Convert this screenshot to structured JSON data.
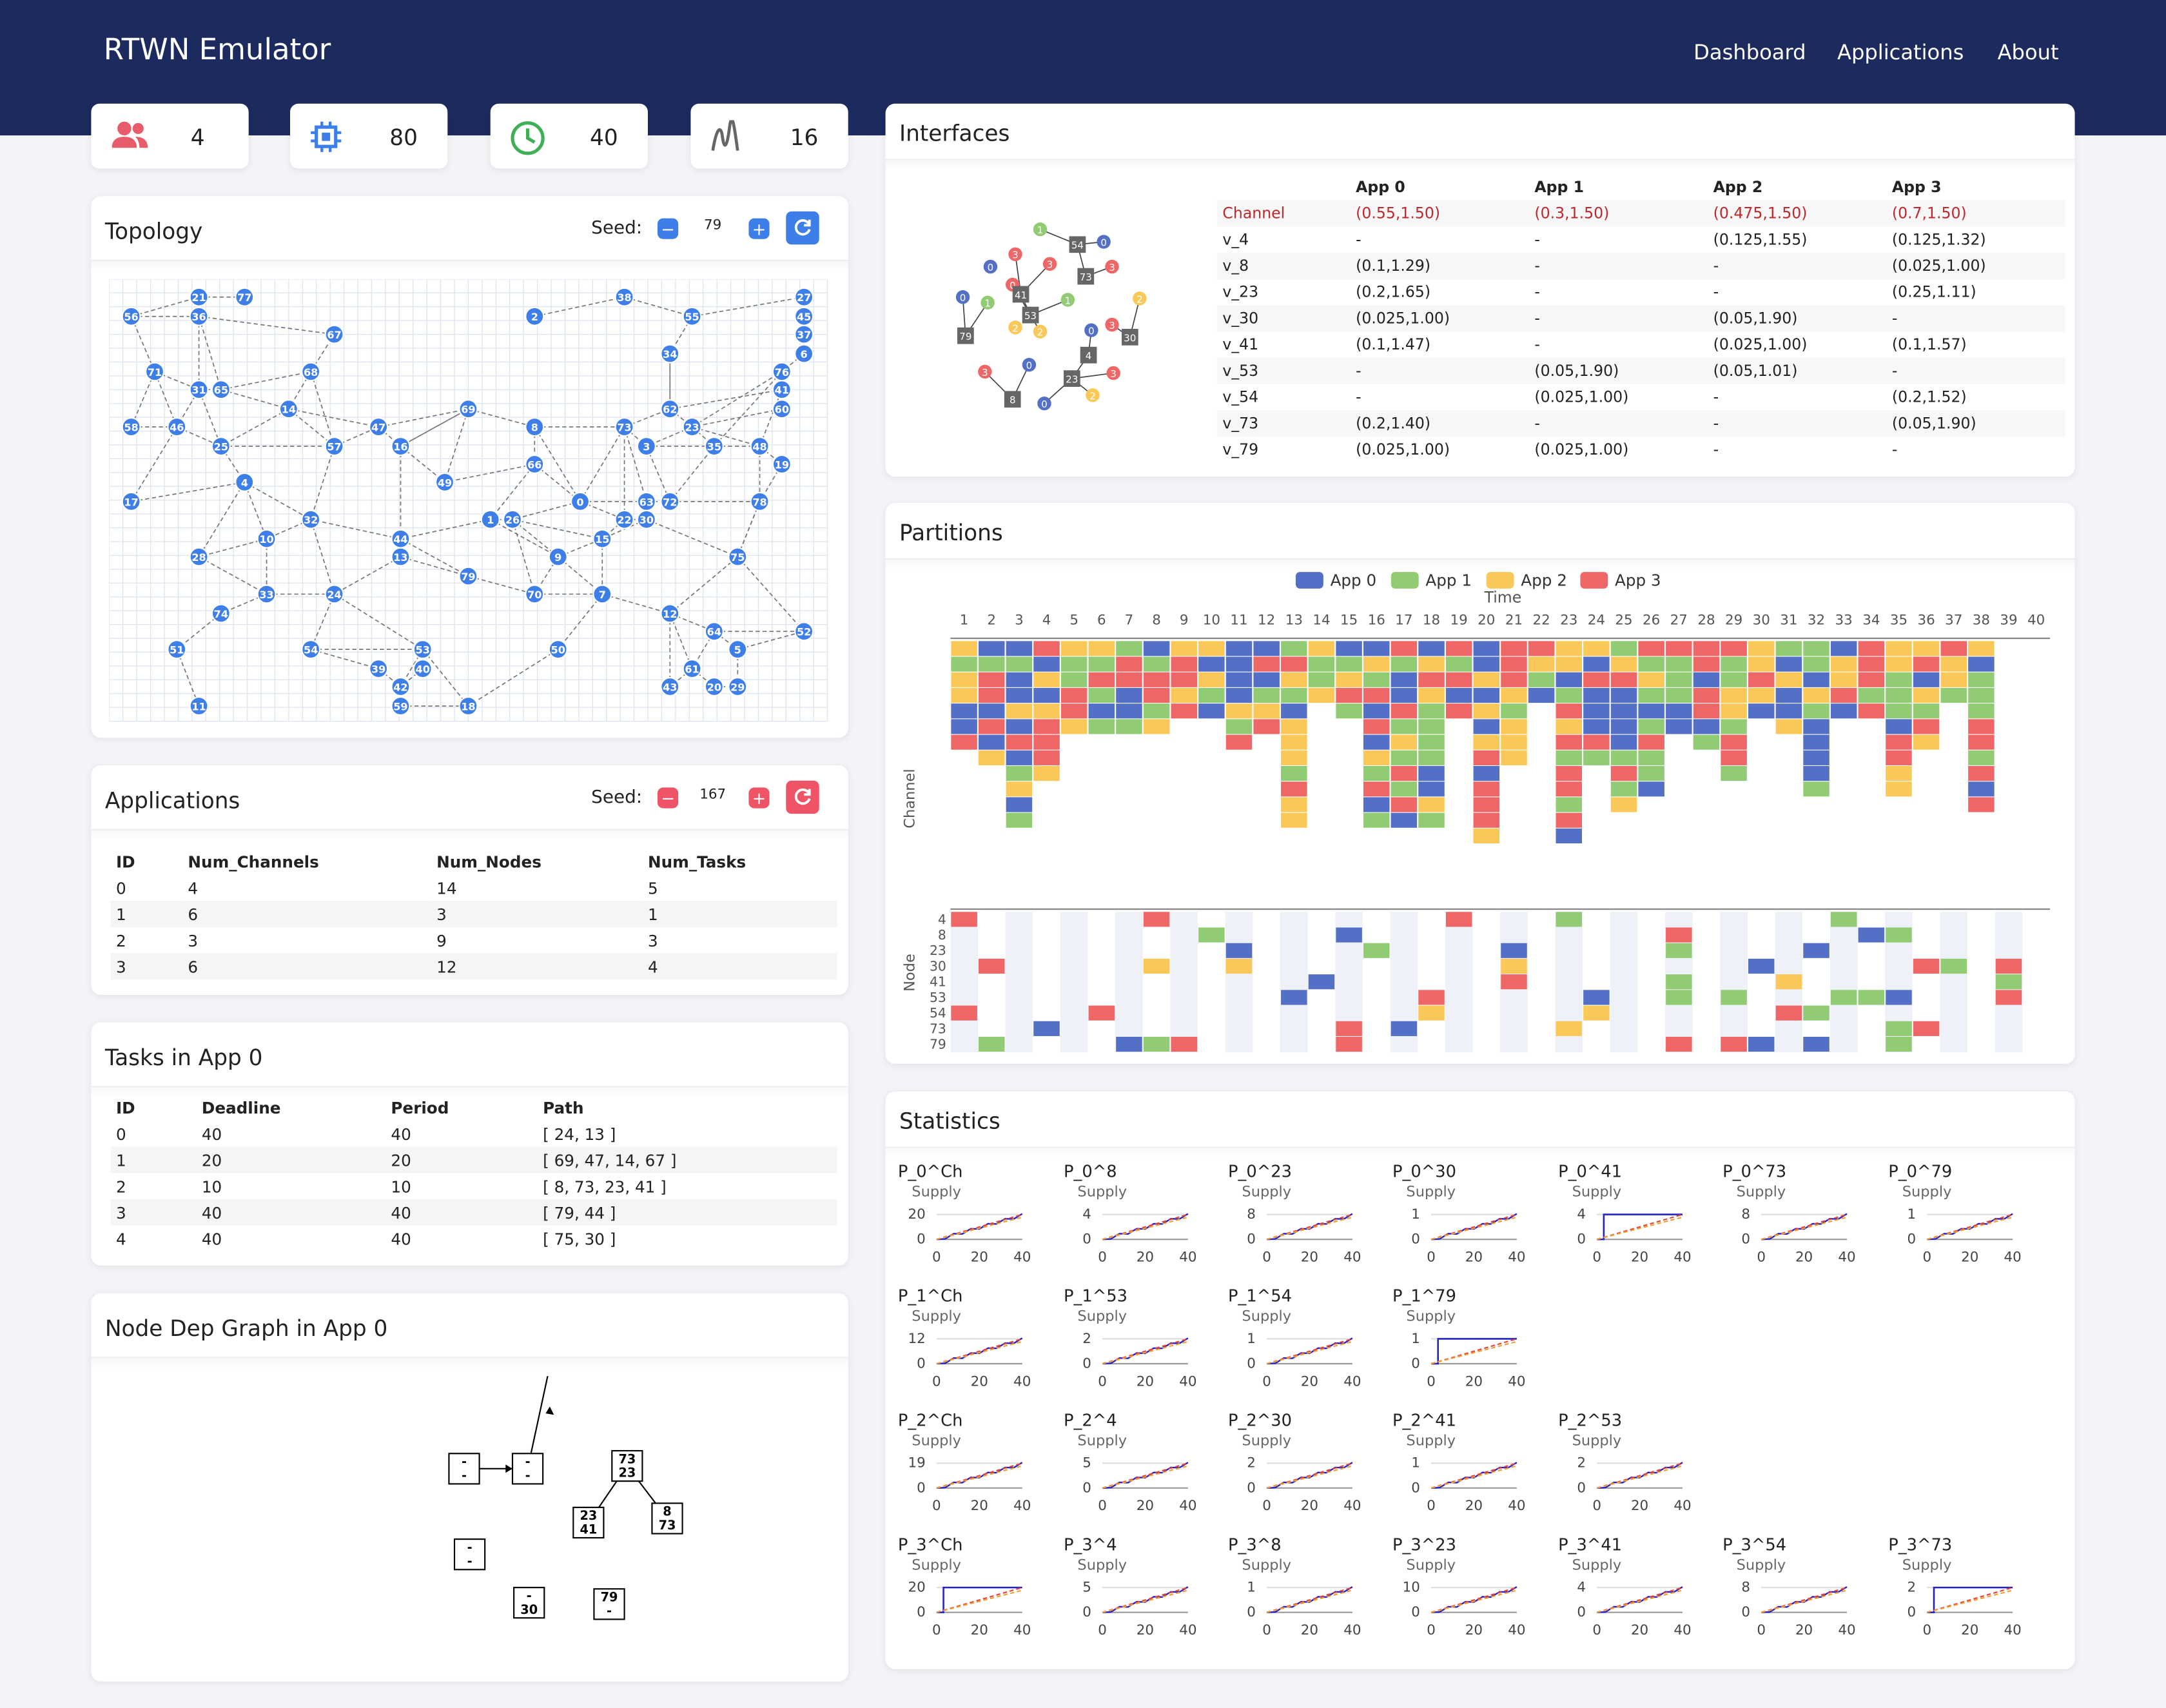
{
  "app": {
    "title": "RTWN Emulator",
    "nav": [
      "Dashboard",
      "Applications",
      "About"
    ]
  },
  "stats": {
    "apps": "4",
    "nodes": "80",
    "time": "40",
    "channels": "16"
  },
  "topology": {
    "title": "Topology",
    "seed_label": "Seed:",
    "seed": "79"
  },
  "applications": {
    "title": "Applications",
    "seed_label": "Seed:",
    "seed": "167",
    "columns": [
      "ID",
      "Num_Channels",
      "Num_Nodes",
      "Num_Tasks"
    ],
    "rows": [
      [
        "0",
        "4",
        "14",
        "5"
      ],
      [
        "1",
        "6",
        "3",
        "1"
      ],
      [
        "2",
        "3",
        "9",
        "3"
      ],
      [
        "3",
        "6",
        "12",
        "4"
      ]
    ]
  },
  "tasks": {
    "title": "Tasks in App 0",
    "columns": [
      "ID",
      "Deadline",
      "Period",
      "Path"
    ],
    "rows": [
      [
        "0",
        "40",
        "40",
        "[ 24, 13 ]"
      ],
      [
        "1",
        "20",
        "20",
        "[ 69, 47, 14, 67 ]"
      ],
      [
        "2",
        "10",
        "10",
        "[ 8, 73, 23, 41 ]"
      ],
      [
        "3",
        "40",
        "40",
        "[ 79, 44 ]"
      ],
      [
        "4",
        "40",
        "40",
        "[ 75, 30 ]"
      ]
    ]
  },
  "depgraph": {
    "title": "Node Dep Graph in App 0",
    "boxes": [
      [
        "-",
        "-"
      ],
      [
        "-",
        "-"
      ],
      [
        "-",
        "-"
      ],
      [
        "73",
        "23"
      ],
      [
        "23",
        "41"
      ],
      [
        "8",
        "73"
      ],
      [
        "-",
        "-"
      ],
      [
        "-",
        "30"
      ],
      [
        "79",
        "-"
      ]
    ]
  },
  "interfaces": {
    "title": "Interfaces",
    "columns": [
      "",
      "App 0",
      "App 1",
      "App 2",
      "App 3"
    ],
    "rows": [
      [
        "Channel",
        "(0.55,1.50)",
        "(0.3,1.50)",
        "(0.475,1.50)",
        "(0.7,1.50)"
      ],
      [
        "v_4",
        "-",
        "-",
        "(0.125,1.55)",
        "(0.125,1.32)"
      ],
      [
        "v_8",
        "(0.1,1.29)",
        "-",
        "-",
        "(0.025,1.00)"
      ],
      [
        "v_23",
        "(0.2,1.65)",
        "-",
        "-",
        "(0.25,1.11)"
      ],
      [
        "v_30",
        "(0.025,1.00)",
        "-",
        "(0.05,1.90)",
        "-"
      ],
      [
        "v_41",
        "(0.1,1.47)",
        "-",
        "(0.025,1.00)",
        "(0.1,1.57)"
      ],
      [
        "v_53",
        "-",
        "(0.05,1.90)",
        "(0.05,1.01)",
        "-"
      ],
      [
        "v_54",
        "-",
        "(0.025,1.00)",
        "-",
        "(0.2,1.52)"
      ],
      [
        "v_73",
        "(0.2,1.40)",
        "-",
        "-",
        "(0.05,1.90)"
      ],
      [
        "v_79",
        "(0.025,1.00)",
        "(0.025,1.00)",
        "-",
        "-"
      ]
    ],
    "graph_nodes": [
      "54",
      "41",
      "53",
      "73",
      "79",
      "4",
      "23",
      "30",
      "8"
    ]
  },
  "partitions": {
    "title": "Partitions",
    "legend": [
      "App 0",
      "App 1",
      "App 2",
      "App 3"
    ],
    "colors": [
      "#5470c6",
      "#91cc75",
      "#fac858",
      "#ee6666"
    ],
    "time_label": "Time",
    "channel_label": "Channel",
    "node_label": "Node",
    "node_rows": [
      "4",
      "8",
      "23",
      "30",
      "41",
      "53",
      "54",
      "73",
      "79"
    ]
  },
  "statistics": {
    "title": "Statistics",
    "sub": "Supply",
    "charts": [
      {
        "t": "P_0^Ch",
        "y": "20",
        "r": 0
      },
      {
        "t": "P_0^8",
        "y": "4",
        "r": 0
      },
      {
        "t": "P_0^23",
        "y": "8",
        "r": 0
      },
      {
        "t": "P_0^30",
        "y": "1",
        "r": 0
      },
      {
        "t": "P_0^41",
        "y": "4",
        "r": 0
      },
      {
        "t": "P_0^73",
        "y": "8",
        "r": 0
      },
      {
        "t": "P_0^79",
        "y": "1",
        "r": 0
      },
      {
        "t": "P_1^Ch",
        "y": "12",
        "r": 1
      },
      {
        "t": "P_1^53",
        "y": "2",
        "r": 1
      },
      {
        "t": "P_1^54",
        "y": "1",
        "r": 1
      },
      {
        "t": "P_1^79",
        "y": "1",
        "r": 1
      },
      {
        "t": "P_2^Ch",
        "y": "19",
        "r": 2
      },
      {
        "t": "P_2^4",
        "y": "5",
        "r": 2
      },
      {
        "t": "P_2^30",
        "y": "2",
        "r": 2
      },
      {
        "t": "P_2^41",
        "y": "1",
        "r": 2
      },
      {
        "t": "P_2^53",
        "y": "2",
        "r": 2
      },
      {
        "t": "P_3^Ch",
        "y": "20",
        "r": 3
      },
      {
        "t": "P_3^4",
        "y": "5",
        "r": 3
      },
      {
        "t": "P_3^8",
        "y": "1",
        "r": 3
      },
      {
        "t": "P_3^23",
        "y": "10",
        "r": 3
      },
      {
        "t": "P_3^41",
        "y": "4",
        "r": 3
      },
      {
        "t": "P_3^54",
        "y": "8",
        "r": 3
      },
      {
        "t": "P_3^73",
        "y": "2",
        "r": 3
      }
    ],
    "x_ticks": [
      "0",
      "20",
      "40"
    ]
  }
}
